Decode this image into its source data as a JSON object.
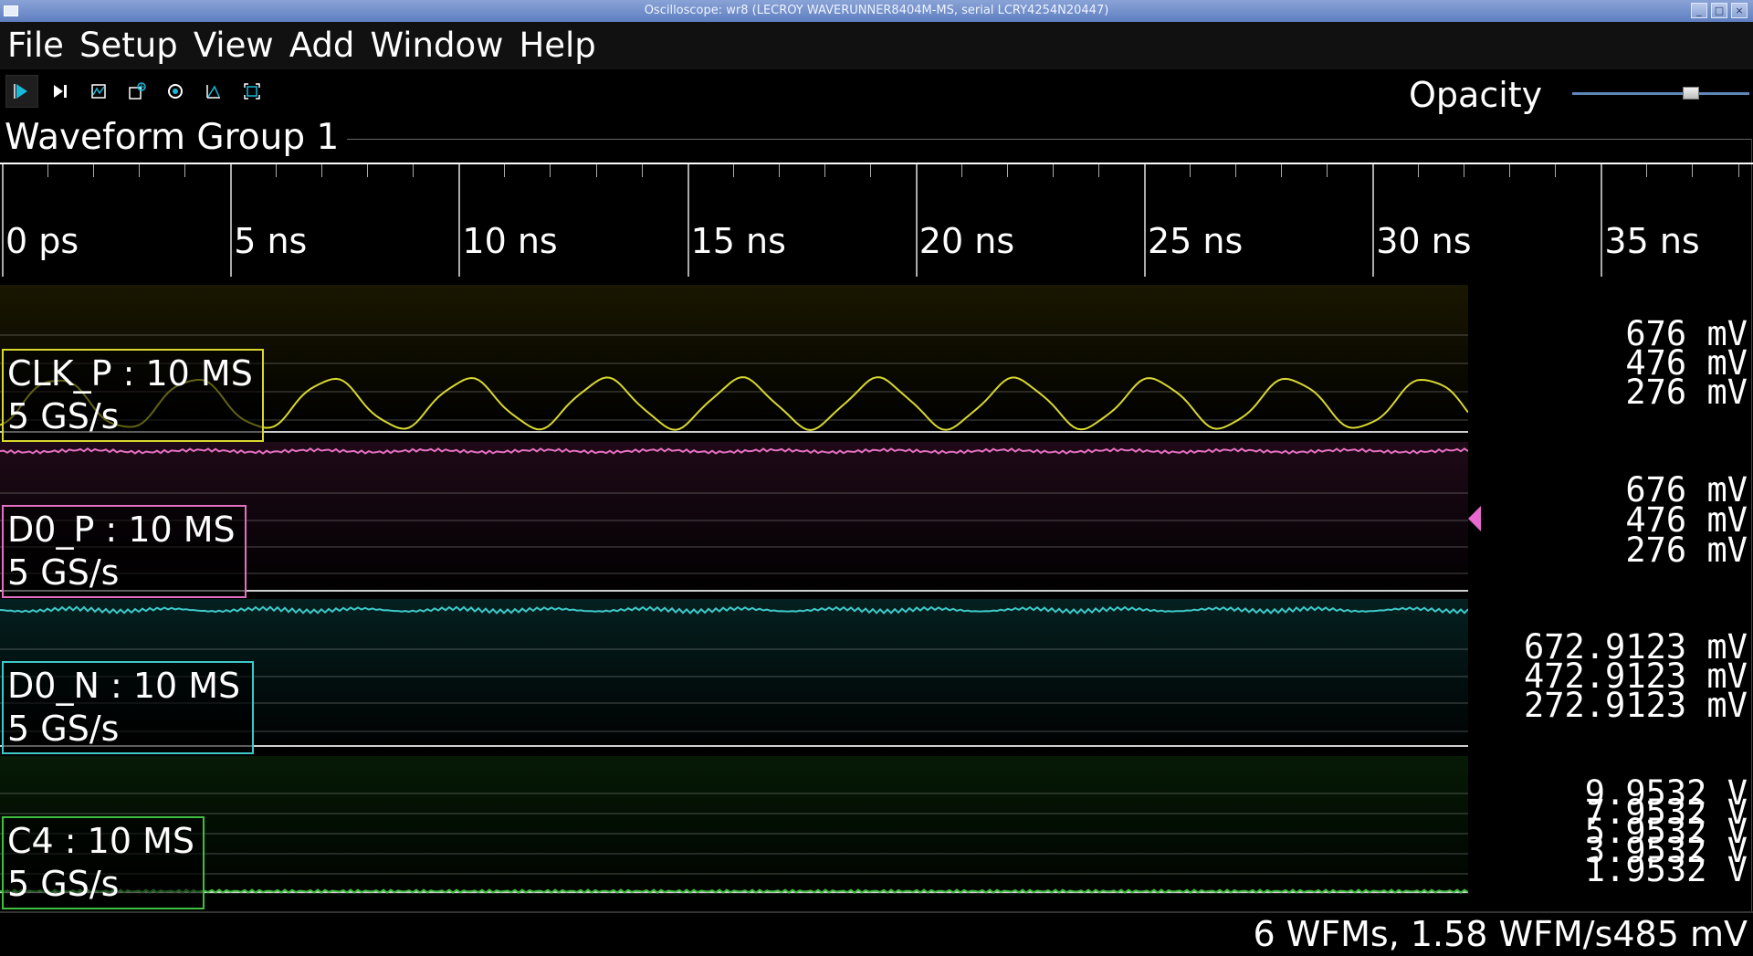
{
  "window": {
    "title": "Oscilloscope: wr8 (LECROY WAVERUNNER8404M-MS, serial LCRY4254N20447)",
    "controls": [
      "_",
      "□",
      "×"
    ]
  },
  "menu": [
    "File",
    "Setup",
    "View",
    "Add",
    "Window",
    "Help"
  ],
  "toolbar": {
    "icons": [
      "play-icon",
      "step-icon",
      "trigger-icon",
      "add-channel-icon",
      "settings-icon",
      "measure-icon",
      "zoom-fit-icon"
    ],
    "opacity_label": "Opacity",
    "opacity_value": 0.62
  },
  "group": {
    "title": "Waveform Group 1"
  },
  "timeline": {
    "labels": [
      "0 ps",
      "5 ns",
      "10 ns",
      "15 ns",
      "20 ns",
      "25 ns",
      "30 ns",
      "35 ns"
    ]
  },
  "channels": [
    {
      "name": "CLK_P : 10 MS",
      "rate": "5 GS/s",
      "color": "#d8d830",
      "bg": "#1a1700",
      "axis": [
        "676 mV",
        "476 mV",
        "276 mV"
      ]
    },
    {
      "name": "D0_P : 10 MS",
      "rate": "5 GS/s",
      "color": "#e36fc0",
      "bg": "#1f0a18",
      "axis": [
        "676 mV",
        "476 mV",
        "276 mV"
      ]
    },
    {
      "name": "D0_N : 10 MS",
      "rate": "5 GS/s",
      "color": "#3ec9c9",
      "bg": "#052020",
      "axis": [
        "672.9123 mV",
        "472.9123 mV",
        "272.9123 mV"
      ]
    },
    {
      "name": "C4 : 10 MS",
      "rate": "5 GS/s",
      "color": "#3fbf3f",
      "bg": "#061a06",
      "axis": [
        "9.9532 V",
        "7.9532 V",
        "5.9532 V",
        "3.9532 V",
        "1.9532 V"
      ]
    }
  ],
  "trigger_marker_color": "#e86ad0",
  "status": "6 WFMs, 1.58 WFM/s485 mV"
}
